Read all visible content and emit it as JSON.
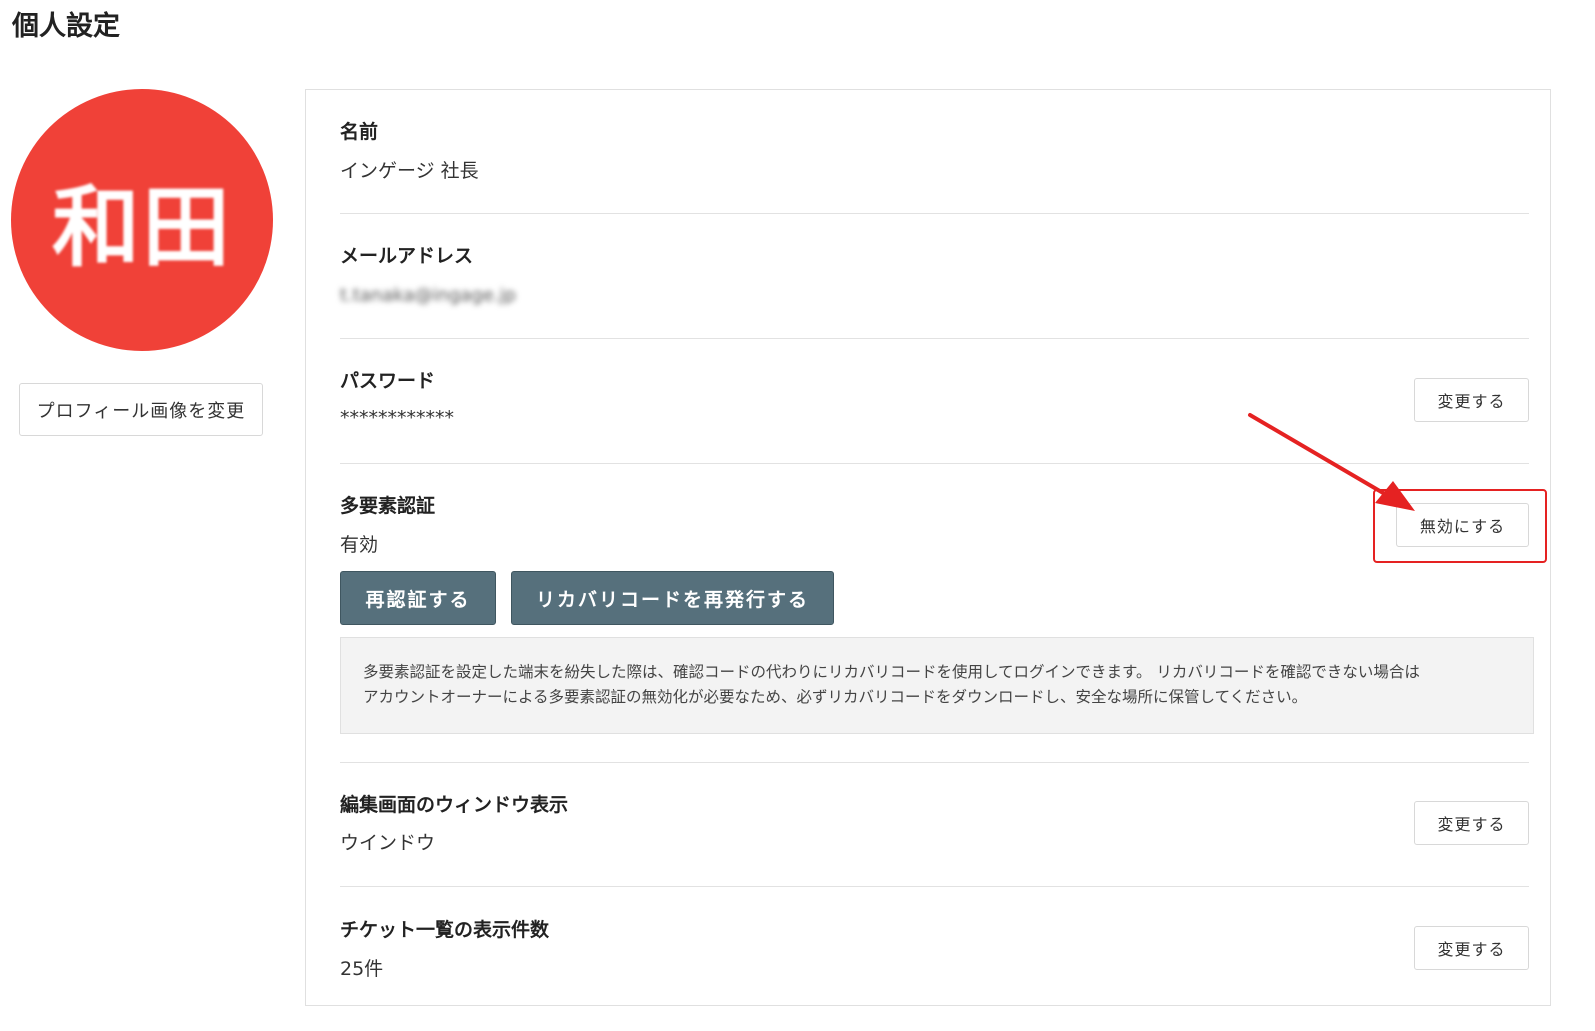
{
  "page_title": "個人設定",
  "avatar": {
    "initials": "和田",
    "color": "#f04138"
  },
  "change_image_button": "プロフィール画像を変更",
  "fields": {
    "name": {
      "label": "名前",
      "value": "インゲージ 社長"
    },
    "email": {
      "label": "メールアドレス",
      "value": "t.tanaka@ingage.jp"
    },
    "password": {
      "label": "パスワード",
      "value": "************",
      "button": "変更する"
    },
    "mfa": {
      "label": "多要素認証",
      "value": "有効",
      "disable_button": "無効にする",
      "reauth_button": "再認証する",
      "reissue_button": "リカバリコードを再発行する",
      "info_line1": "多要素認証を設定した端末を紛失した際は、確認コードの代わりにリカバリコードを使用してログインできます。 リカバリコードを確認できない場合は",
      "info_line2": "アカウントオーナーによる多要素認証の無効化が必要なため、必ずリカバリコードをダウンロードし、安全な場所に保管してください。"
    },
    "window": {
      "label": "編集画面のウィンドウ表示",
      "value": "ウインドウ",
      "button": "変更する"
    },
    "tickets": {
      "label": "チケット一覧の表示件数",
      "value": "25件",
      "button": "変更する"
    }
  },
  "colors": {
    "accent_button": "#56707c",
    "highlight": "#e52222"
  }
}
